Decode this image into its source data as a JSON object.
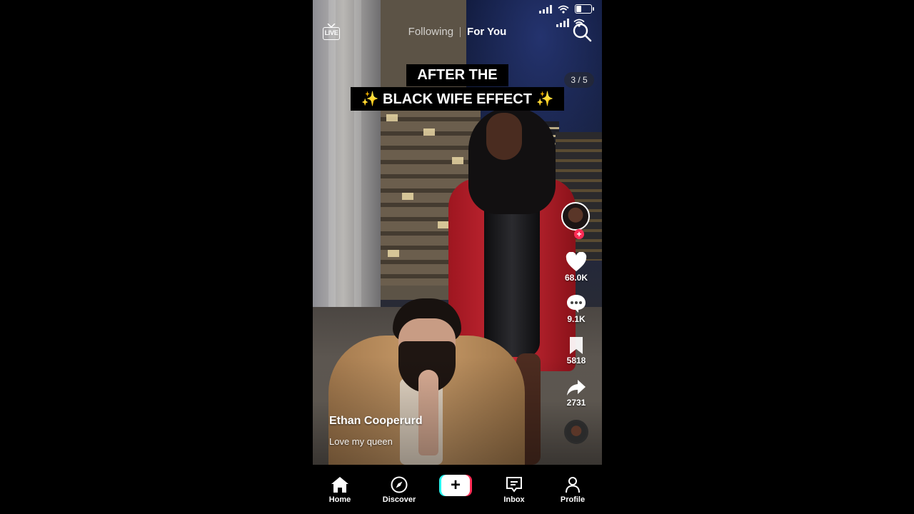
{
  "status_bar": {
    "wifi_icon": "wifi-icon",
    "battery_icon": "battery-icon",
    "signal_icon": "signal-icon"
  },
  "header": {
    "live_label": "LIVE",
    "tabs": [
      {
        "label": "Following"
      },
      {
        "label": "For You"
      }
    ],
    "active_tab": "For You",
    "search_icon": "search-icon"
  },
  "video": {
    "caption_line1": "AFTER THE",
    "caption_line2": "✨ BLACK WIFE EFFECT ✨",
    "page_indicator": "3 / 5",
    "username": "Ethan Cooperurd",
    "description": "Love my queen"
  },
  "actions": {
    "likes": "68.0K",
    "comments": "9.1K",
    "saves": "5818",
    "shares": "2731",
    "follow_label": "+"
  },
  "nav": {
    "items": [
      {
        "label": "Home",
        "icon": "home-icon"
      },
      {
        "label": "Discover",
        "icon": "compass-icon"
      },
      {
        "label": "",
        "icon": "plus-icon"
      },
      {
        "label": "Inbox",
        "icon": "inbox-icon"
      },
      {
        "label": "Profile",
        "icon": "profile-icon"
      }
    ],
    "create_label": "+"
  },
  "colors": {
    "accent_red": "#fe2c55",
    "accent_cyan": "#25f4ee",
    "background": "#000000"
  }
}
